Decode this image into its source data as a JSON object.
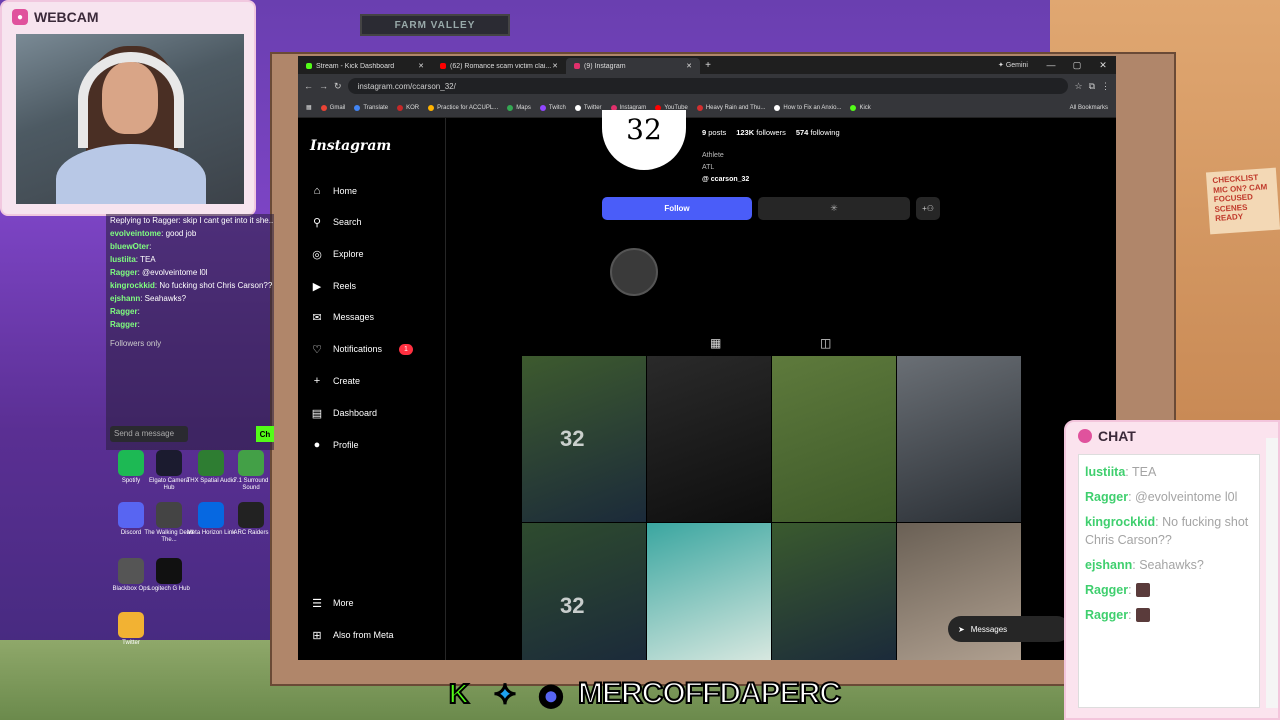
{
  "webcam": {
    "title": "WEBCAM"
  },
  "side_chat": {
    "lines": [
      {
        "user": "",
        "text": "Replying to Ragger: skip I cant get into it she..."
      },
      {
        "user": "evolveintome",
        "text": ": good job"
      },
      {
        "user": "bluewOter",
        "text": ":"
      },
      {
        "user": "lustiita",
        "text": ": TEA"
      },
      {
        "user": "Ragger",
        "text": ": @evolveintome l0l"
      },
      {
        "user": "kingrockkid",
        "text": ": No fucking shot Chris Carson??"
      },
      {
        "user": "ejshann",
        "text": ": Seahawks?"
      },
      {
        "user": "Ragger",
        "text": ":"
      },
      {
        "user": "Ragger",
        "text": ":"
      }
    ],
    "followers_only": "Followers only",
    "input_placeholder": "Send a message",
    "chat_button": "Ch"
  },
  "desktop_icons": [
    {
      "label": "Spotify",
      "color": "#1db954"
    },
    {
      "label": "Elgato Camera Hub",
      "color": "#1b1b2f"
    },
    {
      "label": "THX Spatial Audio",
      "color": "#2e7d32"
    },
    {
      "label": "7.1 Surround Sound",
      "color": "#43a047"
    },
    {
      "label": "Discord",
      "color": "#5865f2"
    },
    {
      "label": "The Walking Dead The...",
      "color": "#444"
    },
    {
      "label": "Meta Horizon Link",
      "color": "#0668e1"
    },
    {
      "label": "ARC Raiders",
      "color": "#222"
    },
    {
      "label": "Blackbox Ops",
      "color": "#555"
    },
    {
      "label": "Logitech G Hub",
      "color": "#111"
    },
    {
      "label": "Twitter",
      "color": "#f2b233"
    }
  ],
  "browser": {
    "tabs": [
      {
        "label": "Stream - Kick Dashboard",
        "color": "#53fc18",
        "active": false
      },
      {
        "label": "(62) Romance scam victim clai...",
        "color": "#ff0000",
        "active": false
      },
      {
        "label": "(9) Instagram",
        "color": "#e1306c",
        "active": true
      }
    ],
    "gemini": "Gemini",
    "url": "instagram.com/ccarson_32/",
    "bookmarks": [
      {
        "label": "Gmail",
        "color": "#ea4335"
      },
      {
        "label": "Translate",
        "color": "#4285f4"
      },
      {
        "label": "KOR",
        "color": "#c62828"
      },
      {
        "label": "Practice for ACCUPL...",
        "color": "#ffb300"
      },
      {
        "label": "Maps",
        "color": "#34a853"
      },
      {
        "label": "Twitch",
        "color": "#9146ff"
      },
      {
        "label": "Twitter",
        "color": "#ffffff"
      },
      {
        "label": "Instagram",
        "color": "#e1306c"
      },
      {
        "label": "YouTube",
        "color": "#ff0000"
      },
      {
        "label": "Heavy Rain and Thu...",
        "color": "#d32f2f"
      },
      {
        "label": "How to Fix an Anxio...",
        "color": "#ffffff"
      },
      {
        "label": "Kick",
        "color": "#53fc18"
      }
    ],
    "all_bookmarks": "All Bookmarks"
  },
  "instagram": {
    "logo": "Instagram",
    "nav": [
      {
        "label": "Home",
        "icon": "home-icon",
        "glyph": "⌂"
      },
      {
        "label": "Search",
        "icon": "search-icon",
        "glyph": "⚲"
      },
      {
        "label": "Explore",
        "icon": "explore-icon",
        "glyph": "◎"
      },
      {
        "label": "Reels",
        "icon": "reels-icon",
        "glyph": "▶"
      },
      {
        "label": "Messages",
        "icon": "messages-icon",
        "glyph": "✉"
      },
      {
        "label": "Notifications",
        "icon": "heart-icon",
        "glyph": "♡"
      },
      {
        "label": "Create",
        "icon": "plus-icon",
        "glyph": "+"
      },
      {
        "label": "Dashboard",
        "icon": "dashboard-icon",
        "glyph": "▤"
      },
      {
        "label": "Profile",
        "icon": "profile-icon",
        "glyph": "●"
      }
    ],
    "notifications_badge": "1",
    "more": "More",
    "also_from_meta": "Also from Meta",
    "profile": {
      "pic_text": "32",
      "posts": "9",
      "posts_label": "posts",
      "followers": "123K",
      "followers_label": "followers",
      "following": "574",
      "following_label": "following",
      "category": "Athlete",
      "location": "ATL",
      "threads_handle": "ccarson_32"
    },
    "follow_button": "Follow",
    "messages_float": "Messages",
    "posts": [
      {
        "colors": [
          "#3d5a2e",
          "#1b2a3a"
        ],
        "num": "32"
      },
      {
        "colors": [
          "#2a2a2a",
          "#0e0e0e"
        ],
        "num": ""
      },
      {
        "colors": [
          "#5e7a3c",
          "#3e5a2a"
        ],
        "num": ""
      },
      {
        "colors": [
          "#6a6f75",
          "#2a2f35"
        ],
        "num": ""
      },
      {
        "colors": [
          "#2e4b2e",
          "#1b2a3a"
        ],
        "num": "32"
      },
      {
        "colors": [
          "#3aa6a0",
          "#d8e8e0"
        ],
        "num": ""
      },
      {
        "colors": [
          "#3a5a2e",
          "#1b2a3a"
        ],
        "num": ""
      },
      {
        "colors": [
          "#6a6055",
          "#b0a090"
        ],
        "num": ""
      }
    ]
  },
  "chat_overlay": {
    "title": "CHAT",
    "messages": [
      {
        "user": "lustiita",
        "text": ": TEA"
      },
      {
        "user": "Ragger",
        "text": ": @evolveintome l0l"
      },
      {
        "user": "kingrockkid",
        "text": ": No fucking shot Chris Carson??"
      },
      {
        "user": "ejshann",
        "text": ": Seahawks?"
      },
      {
        "user": "Ragger",
        "text": ":"
      },
      {
        "user": "Ragger",
        "text": ":"
      }
    ]
  },
  "banner": {
    "name": "MERCOFFDAPERC"
  }
}
